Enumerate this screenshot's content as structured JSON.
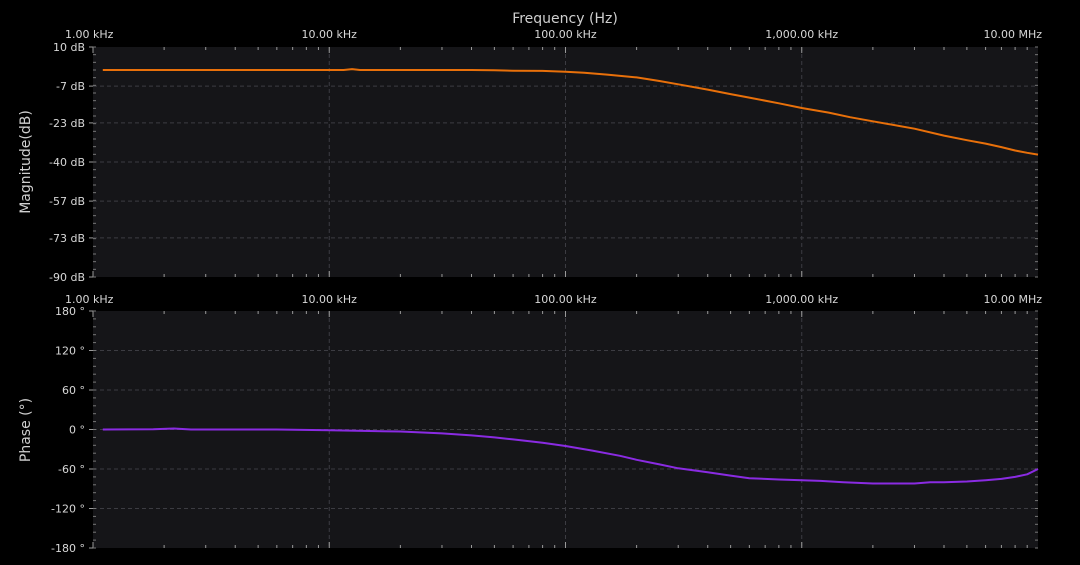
{
  "colors": {
    "background": "#000000",
    "plot_background": "#151518",
    "grid_major": "#3c3c42",
    "grid_minor": "#26262b",
    "tick_text": "#d8d8d8",
    "magnitude_trace": "#e8700a",
    "phase_trace": "#8a2be2"
  },
  "chart_data": [
    {
      "type": "line",
      "title": "Frequency (Hz)",
      "xlabel": "Frequency (Hz)",
      "ylabel": "Magnitude(dB)",
      "x_scale": "log",
      "xlim": [
        1000,
        10000000
      ],
      "ylim": [
        -90,
        10
      ],
      "x_ticks": [
        1000,
        10000,
        100000,
        1000000,
        10000000
      ],
      "x_tick_labels": [
        "1.00 kHz",
        "10.00 kHz",
        "100.00 kHz",
        "1,000.00 kHz",
        "10.00 MHz"
      ],
      "y_ticks": [
        10,
        -7,
        -23,
        -40,
        -57,
        -73,
        -90
      ],
      "y_tick_labels": [
        "10 dB",
        "-7 dB",
        "-23 dB",
        "-40 dB",
        "-57 dB",
        "-73 dB",
        "-90 dB"
      ],
      "grid": true,
      "series": [
        {
          "color": "#e8700a",
          "x": [
            1100,
            2000,
            5000,
            10000,
            11500,
            12500,
            13500,
            20000,
            40000,
            50000,
            60000,
            80000,
            100000,
            120000,
            150000,
            200000,
            250000,
            300000,
            400000,
            500000,
            600000,
            800000,
            1000000,
            1300000,
            1600000,
            2000000,
            3000000,
            4000000,
            5000000,
            6000000,
            7000000,
            8000000,
            9000000,
            10000000
          ],
          "y": [
            0.0,
            0.0,
            0.0,
            0.0,
            0.0,
            0.4,
            0.0,
            0.0,
            0.0,
            -0.1,
            -0.3,
            -0.4,
            -0.8,
            -1.2,
            -2.0,
            -3.2,
            -4.8,
            -6.2,
            -8.5,
            -10.5,
            -12.0,
            -14.5,
            -16.5,
            -18.5,
            -20.5,
            -22.3,
            -25.5,
            -28.5,
            -30.5,
            -32.0,
            -33.5,
            -35.0,
            -36.0,
            -36.8
          ]
        }
      ]
    },
    {
      "type": "line",
      "xlabel": "",
      "ylabel": "Phase (°)",
      "x_scale": "log",
      "xlim": [
        1000,
        10000000
      ],
      "ylim": [
        -180,
        180
      ],
      "x_ticks": [
        1000,
        10000,
        100000,
        1000000,
        10000000
      ],
      "x_tick_labels": [
        "1.00 kHz",
        "10.00 kHz",
        "100.00 kHz",
        "1,000.00 kHz",
        "10.00 MHz"
      ],
      "y_ticks": [
        180,
        120,
        60,
        0,
        -60,
        -120,
        -180
      ],
      "y_tick_labels": [
        "180 °",
        "120 °",
        "60 °",
        "0 °",
        "-60 °",
        "-120 °",
        "-180 °"
      ],
      "grid": true,
      "series": [
        {
          "color": "#8a2be2",
          "x": [
            1100,
            1800,
            2200,
            2600,
            4000,
            6000,
            10000,
            13000,
            20000,
            30000,
            40000,
            50000,
            60000,
            80000,
            100000,
            130000,
            170000,
            200000,
            250000,
            300000,
            400000,
            500000,
            600000,
            800000,
            1000000,
            1200000,
            1500000,
            2000000,
            2500000,
            3000000,
            3500000,
            4000000,
            5000000,
            6000000,
            7000000,
            8000000,
            9000000,
            10000000
          ],
          "y": [
            0,
            0.5,
            1.5,
            0,
            0,
            0,
            -1,
            -2,
            -3,
            -6,
            -9,
            -12,
            -15,
            -20,
            -25,
            -32,
            -40,
            -46,
            -53,
            -59,
            -65,
            -70,
            -74,
            -76,
            -77,
            -78,
            -80,
            -82,
            -82,
            -82,
            -80,
            -80,
            -79,
            -77,
            -75,
            -72,
            -68,
            -60
          ]
        }
      ]
    }
  ]
}
